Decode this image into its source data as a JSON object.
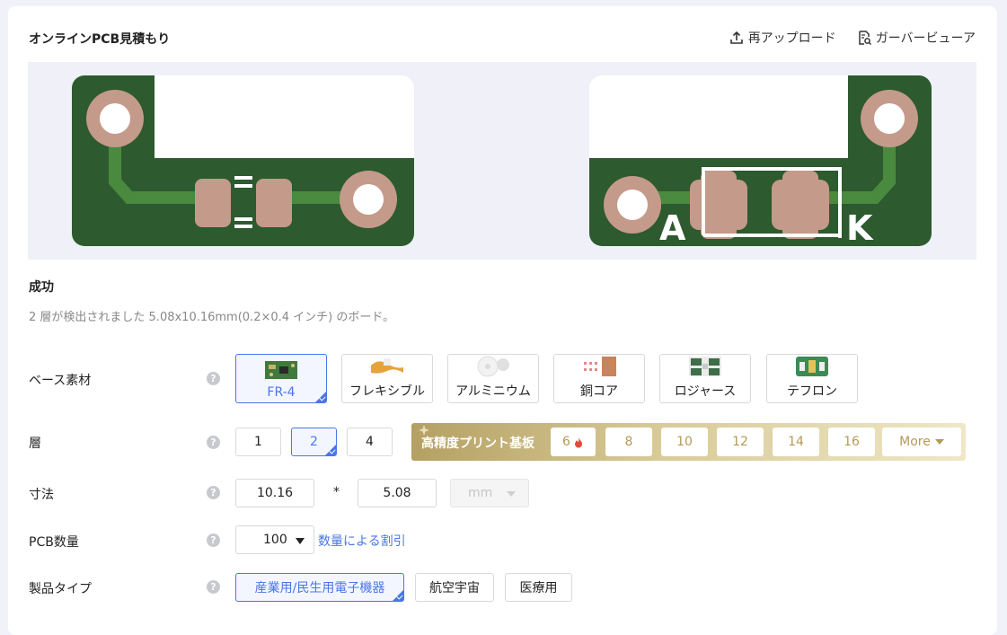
{
  "header": {
    "title": "オンラインPCB見積もり",
    "reupload_label": "再アップロード",
    "gerber_viewer_label": "ガーバービューア"
  },
  "preview": {
    "labels": {
      "anode": "A",
      "cathode": "K"
    },
    "colors": {
      "board": "#2d5a2f",
      "trace": "#4a8a3f",
      "pad": "#c49a8a"
    }
  },
  "status": {
    "title": "成功",
    "description": "2 層が検出されました 5.08x10.16mm(0.2×0.4 インチ) のボード。"
  },
  "base_material": {
    "label": "ベース素材",
    "help": "?",
    "options": [
      "FR-4",
      "フレキシブル",
      "アルミニウム",
      "銅コア",
      "ロジャース",
      "テフロン"
    ],
    "selected": "FR-4"
  },
  "layers": {
    "label": "層",
    "help": "?",
    "options": [
      "1",
      "2",
      "4"
    ],
    "selected": "2",
    "high_precision_label": "高精度プリント基板",
    "high_precision_options": [
      "6",
      "8",
      "10",
      "12",
      "14",
      "16"
    ],
    "more_label": "More"
  },
  "dimensions": {
    "label": "寸法",
    "help": "?",
    "width": "10.16",
    "separator": "*",
    "height": "5.08",
    "unit": "mm"
  },
  "quantity": {
    "label": "PCB数量",
    "help": "?",
    "value": "100",
    "discount_link": "数量による割引"
  },
  "product_type": {
    "label": "製品タイプ",
    "help": "?",
    "options": [
      "産業用/民生用電子機器",
      "航空宇宙",
      "医療用"
    ],
    "selected": "産業用/民生用電子機器"
  },
  "colors": {
    "accent": "#4a76e8",
    "gold": "#b59a55"
  }
}
